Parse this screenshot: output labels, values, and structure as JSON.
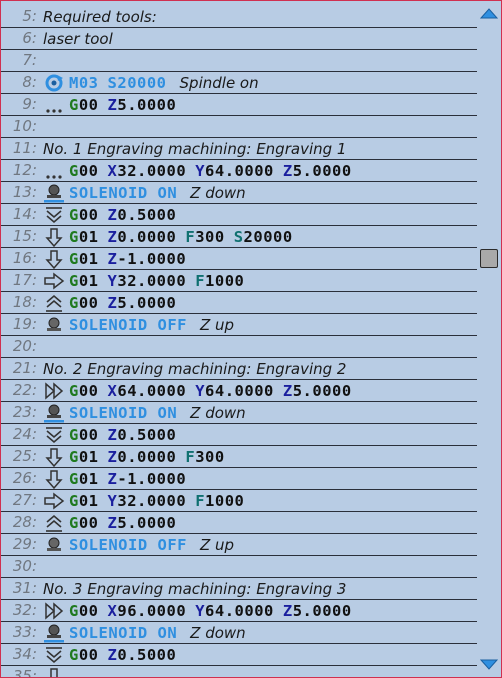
{
  "colors": {
    "G": "#1f7a1f",
    "X": "#1a1f9e",
    "Y": "#1a1f9e",
    "Z": "#1a1f9e",
    "F": "#0f7070",
    "S": "#0f7070",
    "M": "#2f8fe0",
    "SOLENOID": "#2f8fe0",
    "number": "#111111"
  },
  "lines": [
    {
      "n": "5:",
      "comment": "Required tools:"
    },
    {
      "n": "6:",
      "comment": "laser tool"
    },
    {
      "n": "7:"
    },
    {
      "n": "8:",
      "icon": "spindle-on-icon",
      "tokens": [
        {
          "l": "M",
          "v": "03"
        },
        {
          "l": "S",
          "v": "20000"
        }
      ],
      "note": "Spindle on"
    },
    {
      "n": "9:",
      "icon": "rapid-dots-icon",
      "tokens": [
        {
          "l": "G",
          "v": "00"
        },
        {
          "l": "Z",
          "v": "5.0000"
        }
      ]
    },
    {
      "n": "10:"
    },
    {
      "n": "11:",
      "comment": "No. 1 Engraving machining: Engraving 1"
    },
    {
      "n": "12:",
      "icon": "rapid-dots-icon",
      "tokens": [
        {
          "l": "G",
          "v": "00"
        },
        {
          "l": "X",
          "v": "32.0000"
        },
        {
          "l": "Y",
          "v": "64.0000"
        },
        {
          "l": "Z",
          "v": "5.0000"
        }
      ]
    },
    {
      "n": "13:",
      "icon": "solenoid-on-icon",
      "tokens": [
        {
          "l": "SOLENOID",
          "v": " ON",
          "blue": true
        }
      ],
      "note": "Z down"
    },
    {
      "n": "14:",
      "icon": "rapid-down-icon",
      "tokens": [
        {
          "l": "G",
          "v": "00"
        },
        {
          "l": "Z",
          "v": "0.5000"
        }
      ]
    },
    {
      "n": "15:",
      "icon": "feed-down-icon",
      "tokens": [
        {
          "l": "G",
          "v": "01"
        },
        {
          "l": "Z",
          "v": "0.0000"
        },
        {
          "l": "F",
          "v": "300"
        },
        {
          "l": "S",
          "v": "20000"
        }
      ]
    },
    {
      "n": "16:",
      "icon": "feed-down-icon",
      "tokens": [
        {
          "l": "G",
          "v": "01"
        },
        {
          "l": "Z",
          "v": "-1.0000"
        }
      ]
    },
    {
      "n": "17:",
      "icon": "feed-right-icon",
      "tokens": [
        {
          "l": "G",
          "v": "01"
        },
        {
          "l": "Y",
          "v": "32.0000"
        },
        {
          "l": "F",
          "v": "1000"
        }
      ]
    },
    {
      "n": "18:",
      "icon": "rapid-up-icon",
      "tokens": [
        {
          "l": "G",
          "v": "00"
        },
        {
          "l": "Z",
          "v": "5.0000"
        }
      ]
    },
    {
      "n": "19:",
      "icon": "solenoid-off-icon",
      "tokens": [
        {
          "l": "SOLENOID",
          "v": " OFF",
          "blue": true
        }
      ],
      "note": "Z up"
    },
    {
      "n": "20:"
    },
    {
      "n": "21:",
      "comment": "No. 2 Engraving machining: Engraving 2"
    },
    {
      "n": "22:",
      "icon": "rapid-right-icon",
      "tokens": [
        {
          "l": "G",
          "v": "00"
        },
        {
          "l": "X",
          "v": "64.0000"
        },
        {
          "l": "Y",
          "v": "64.0000"
        },
        {
          "l": "Z",
          "v": "5.0000"
        }
      ]
    },
    {
      "n": "23:",
      "icon": "solenoid-on-icon",
      "tokens": [
        {
          "l": "SOLENOID",
          "v": " ON",
          "blue": true
        }
      ],
      "note": "Z down"
    },
    {
      "n": "24:",
      "icon": "rapid-down-icon",
      "tokens": [
        {
          "l": "G",
          "v": "00"
        },
        {
          "l": "Z",
          "v": "0.5000"
        }
      ]
    },
    {
      "n": "25:",
      "icon": "feed-down-icon",
      "tokens": [
        {
          "l": "G",
          "v": "01"
        },
        {
          "l": "Z",
          "v": "0.0000"
        },
        {
          "l": "F",
          "v": "300"
        }
      ]
    },
    {
      "n": "26:",
      "icon": "feed-down-icon",
      "tokens": [
        {
          "l": "G",
          "v": "01"
        },
        {
          "l": "Z",
          "v": "-1.0000"
        }
      ]
    },
    {
      "n": "27:",
      "icon": "feed-right-icon",
      "tokens": [
        {
          "l": "G",
          "v": "01"
        },
        {
          "l": "Y",
          "v": "32.0000"
        },
        {
          "l": "F",
          "v": "1000"
        }
      ]
    },
    {
      "n": "28:",
      "icon": "rapid-up-icon",
      "tokens": [
        {
          "l": "G",
          "v": "00"
        },
        {
          "l": "Z",
          "v": "5.0000"
        }
      ]
    },
    {
      "n": "29:",
      "icon": "solenoid-off-icon",
      "tokens": [
        {
          "l": "SOLENOID",
          "v": " OFF",
          "blue": true
        }
      ],
      "note": "Z up"
    },
    {
      "n": "30:"
    },
    {
      "n": "31:",
      "comment": "No. 3 Engraving machining: Engraving 3"
    },
    {
      "n": "32:",
      "icon": "rapid-right-icon",
      "tokens": [
        {
          "l": "G",
          "v": "00"
        },
        {
          "l": "X",
          "v": "96.0000"
        },
        {
          "l": "Y",
          "v": "64.0000"
        },
        {
          "l": "Z",
          "v": "5.0000"
        }
      ]
    },
    {
      "n": "33:",
      "icon": "solenoid-on-icon",
      "tokens": [
        {
          "l": "SOLENOID",
          "v": " ON",
          "blue": true
        }
      ],
      "note": "Z down"
    },
    {
      "n": "34:",
      "icon": "rapid-down-icon",
      "tokens": [
        {
          "l": "G",
          "v": "00"
        },
        {
          "l": "Z",
          "v": "0.5000"
        }
      ]
    },
    {
      "n": "35:",
      "icon": "feed-down-icon"
    }
  ],
  "scrollbar": {
    "up_icon": "scroll-up-arrow-icon",
    "down_icon": "scroll-down-arrow-icon",
    "position_fraction": 0.37
  }
}
